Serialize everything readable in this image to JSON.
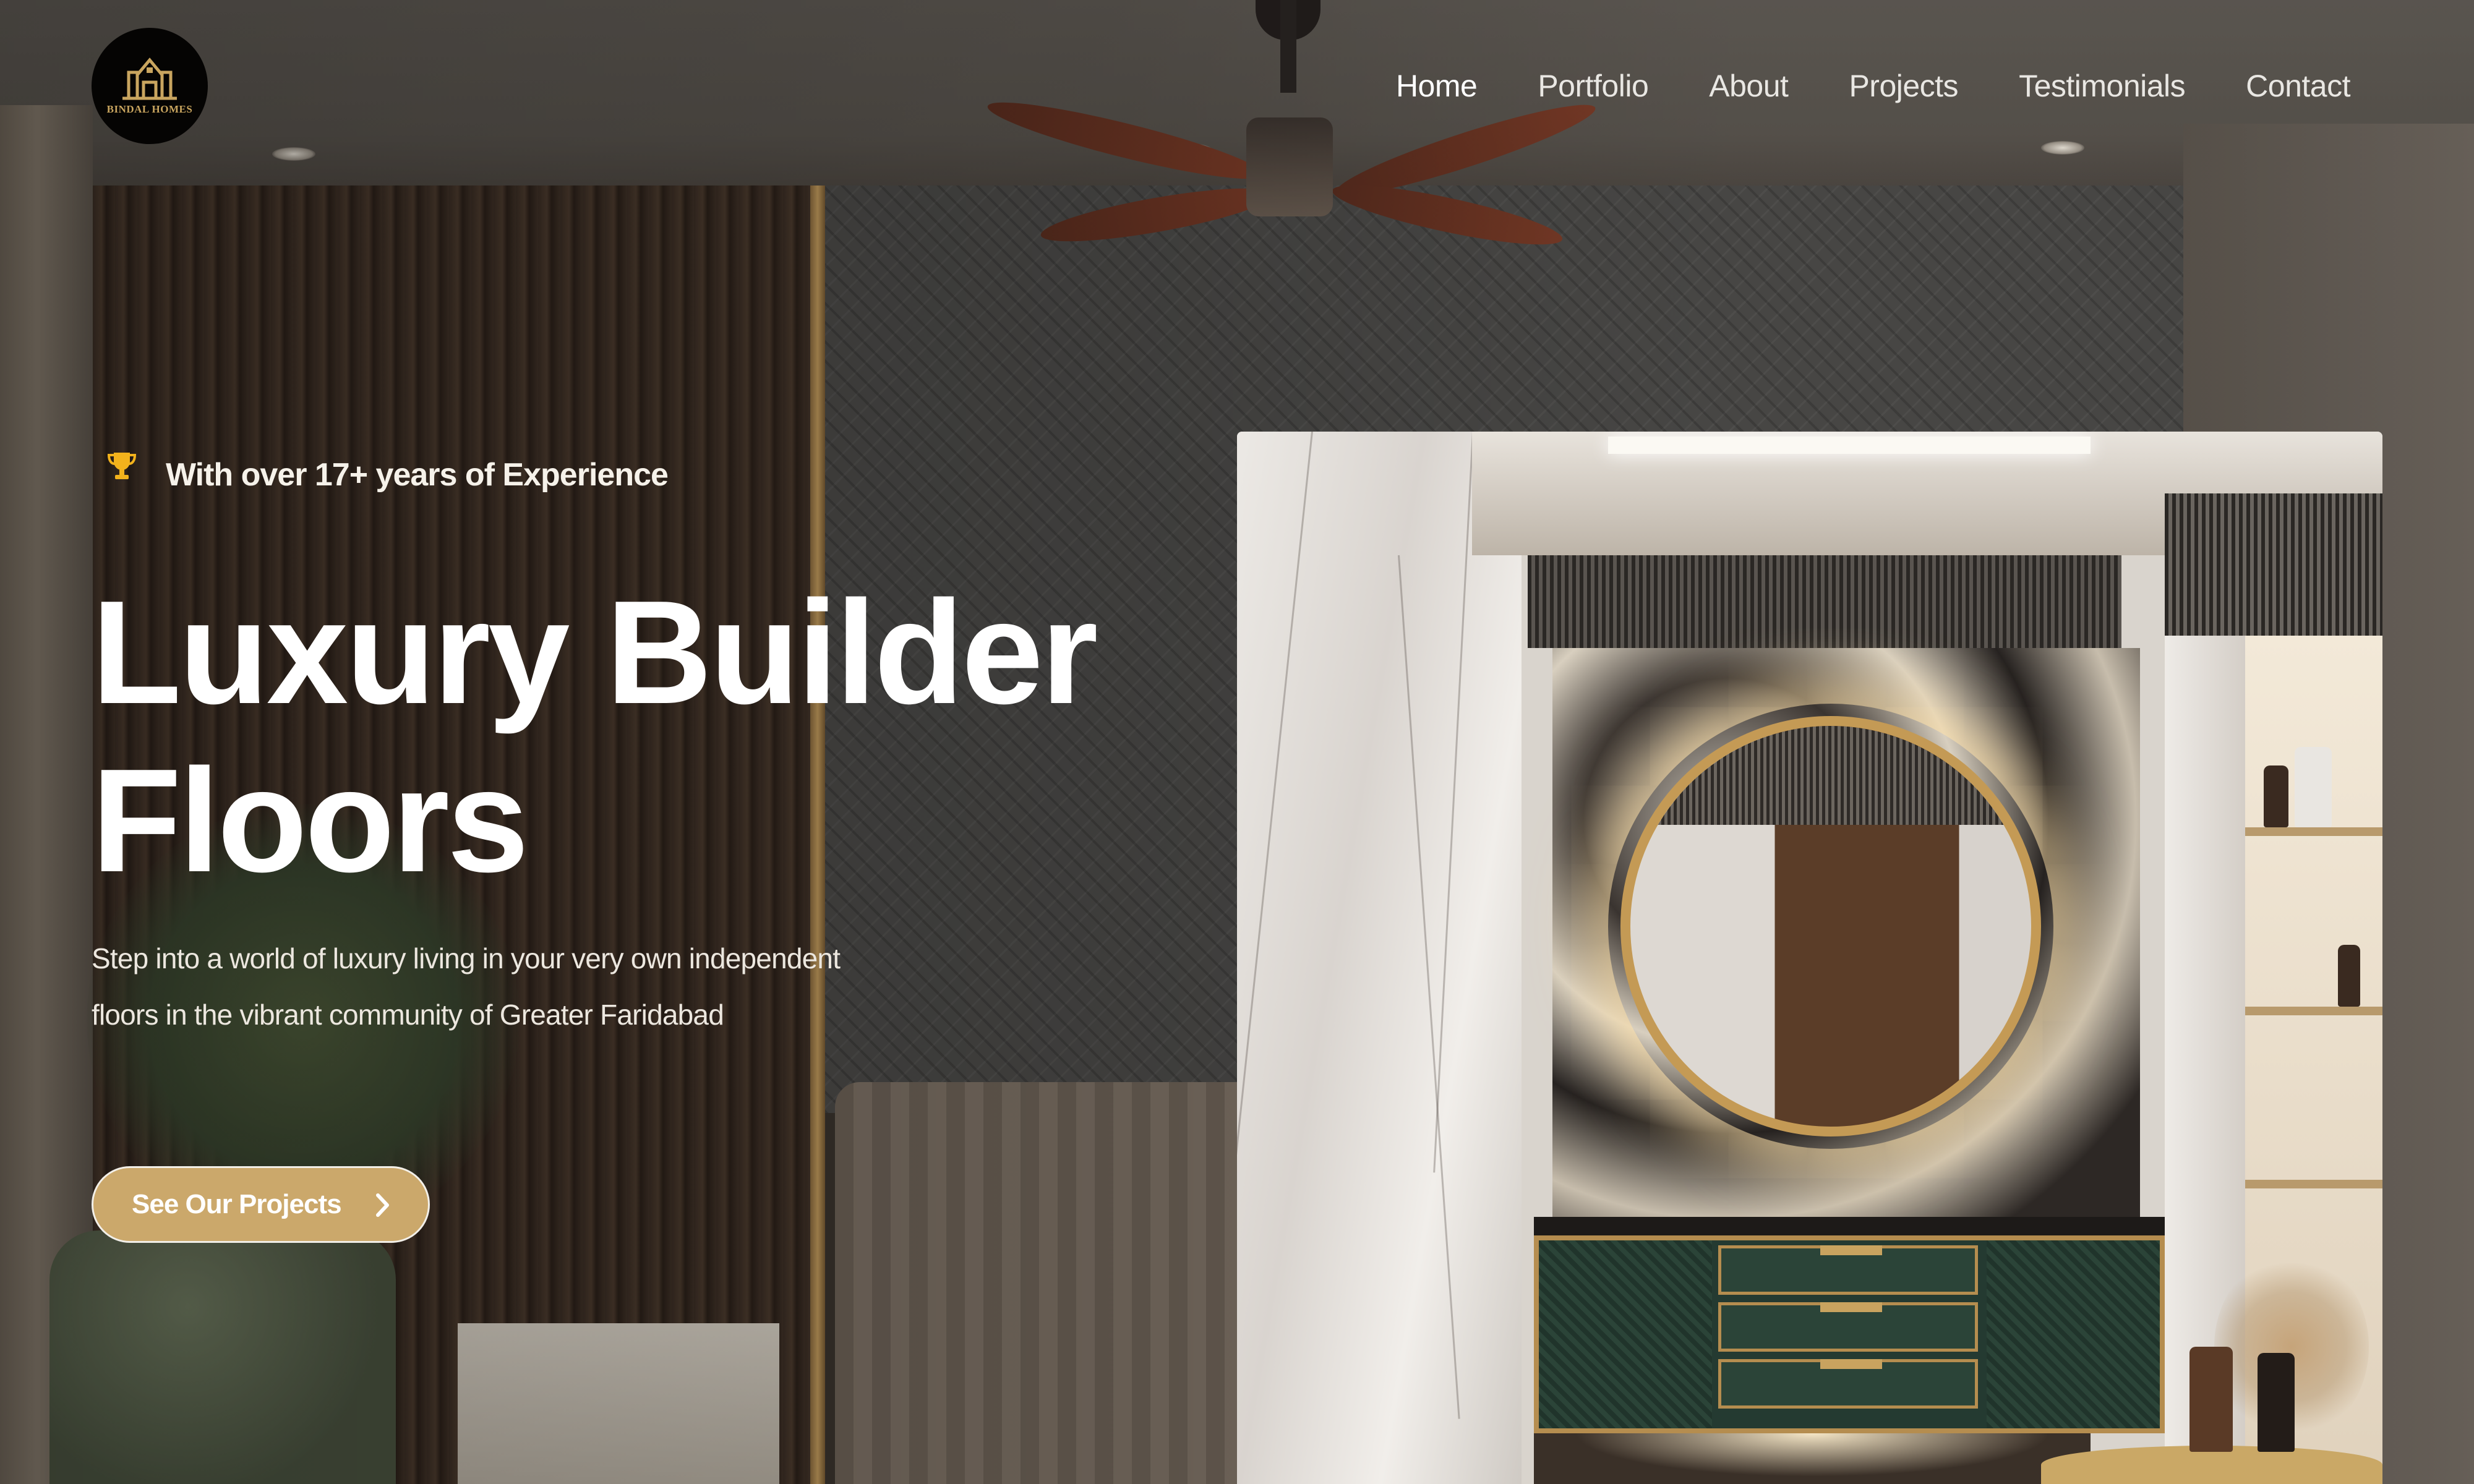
{
  "brand": {
    "name": "BINDAL HOMES",
    "logo_icon": "house-roof-logo-icon"
  },
  "nav": {
    "items": [
      {
        "label": "Home",
        "active": true
      },
      {
        "label": "Portfolio",
        "active": false
      },
      {
        "label": "About",
        "active": false
      },
      {
        "label": "Projects",
        "active": false
      },
      {
        "label": "Testimonials",
        "active": false
      },
      {
        "label": "Contact",
        "active": false
      }
    ]
  },
  "hero": {
    "badge_icon": "trophy-icon",
    "badge_text": "With over 17+ years of Experience",
    "title_line1": "Luxury Builder",
    "title_line2": "Floors",
    "description": "Step into a world of luxury living in your very own independent floors in the vibrant community of Greater Faridabad",
    "cta": {
      "label": "See Our Projects",
      "icon": "chevron-right-icon"
    },
    "image_alt": "Luxury bathroom interior with round backlit mirror and green vanity"
  },
  "colors": {
    "accent_gold": "#cba86b",
    "trophy_gold": "#f2b21c",
    "text_white": "#ffffff",
    "logo_bg": "#050403"
  }
}
